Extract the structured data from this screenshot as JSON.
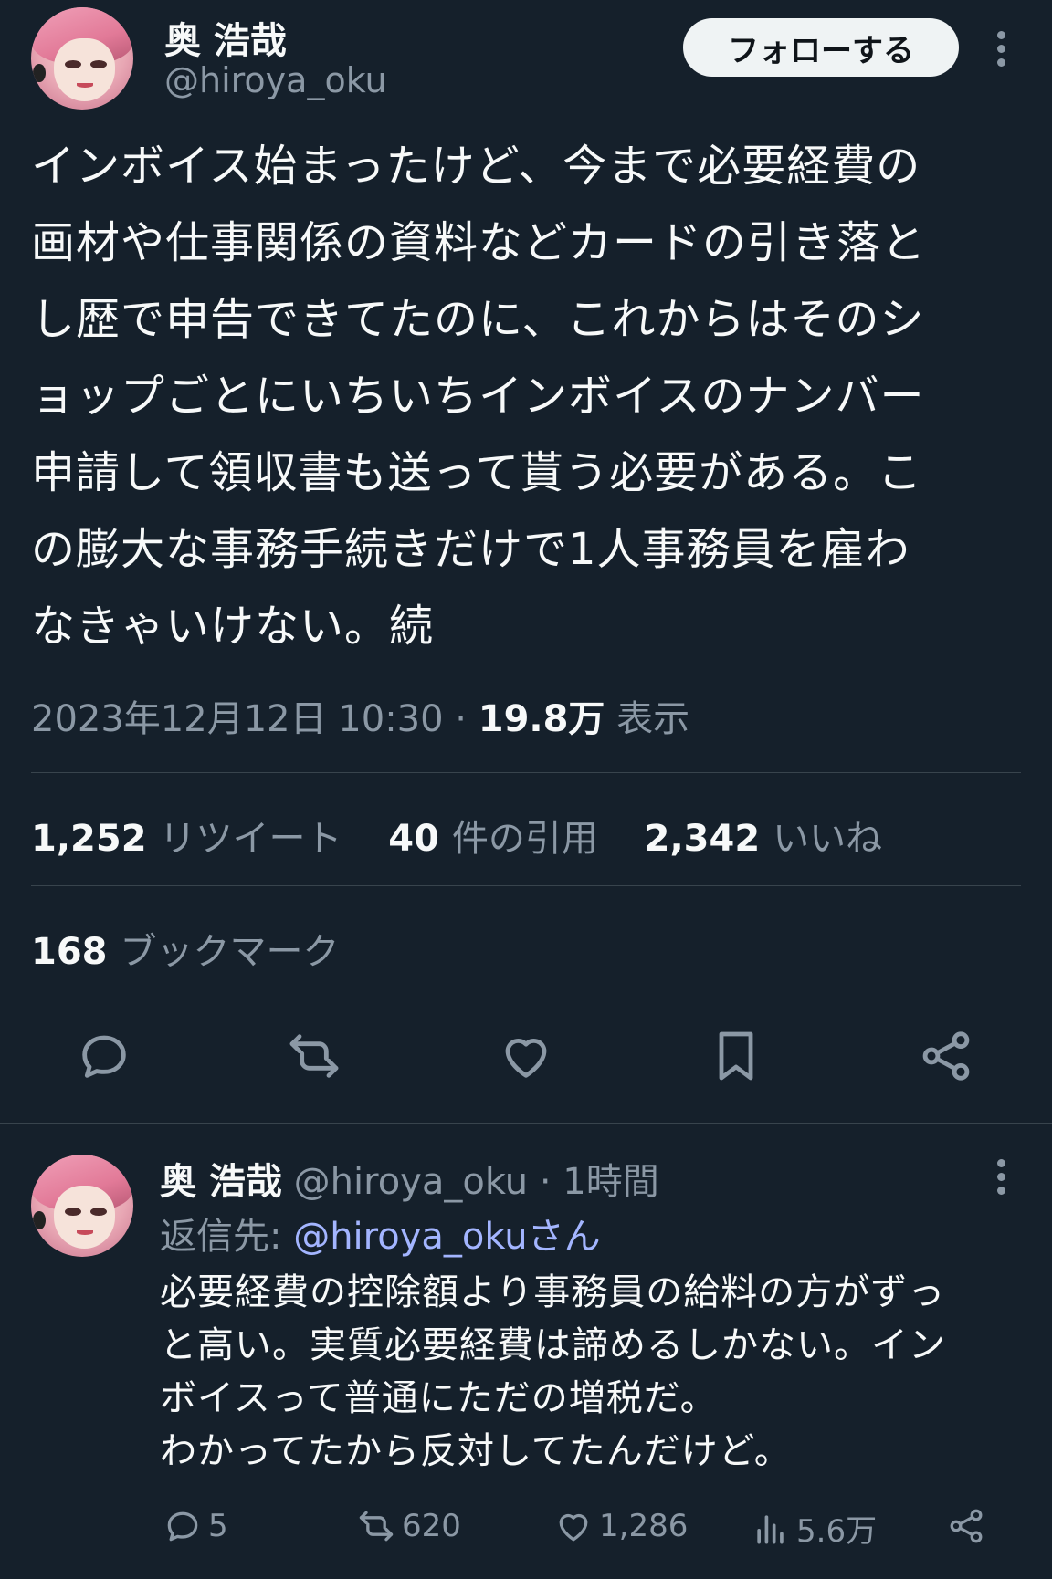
{
  "main": {
    "author_name": "奥 浩哉",
    "author_handle": "@hiroya_oku",
    "follow_label": "フォローする",
    "text_lines": [
      "インボイス始まったけど、今まで必要経費の",
      "画材や仕事関係の資料などカードの引き落と",
      "し歴で申告できてたのに、これからはそのシ",
      "ョップごとにいちいちインボイスのナンバー",
      "申請して領収書も送って貰う必要がある。こ",
      "の膨大な事務手続きだけで1人事務員を雇わ",
      "なきゃいけない。続"
    ],
    "timestamp": "2023年12月12日 10:30 ·",
    "views_count": "19.8万",
    "views_label": "表示",
    "retweets_count": "1,252",
    "retweets_label": "リツイート",
    "quotes_count": "40",
    "quotes_label": "件の引用",
    "likes_count": "2,342",
    "likes_label": "いいね",
    "bookmarks_count": "168",
    "bookmarks_label": "ブックマーク"
  },
  "reply": {
    "author_name": "奥 浩哉",
    "author_handle": "@hiroya_oku · 1時間",
    "reply_to_label": "返信先:",
    "reply_to_mention": "@hiroya_okuさん",
    "text_lines": [
      "必要経費の控除額より事務員の給料の方がずっ",
      "と高い。実質必要経費は諦めるしかない。イン",
      "ボイスって普通にただの増税だ。",
      "わかってたから反対してたんだけど。"
    ],
    "replies": "5",
    "retweets": "620",
    "likes": "1,286",
    "views": "5.6万"
  },
  "icons": [
    "reply-icon",
    "retweet-icon",
    "heart-icon",
    "bookmark-icon",
    "share-icon",
    "views-icon",
    "more-icon"
  ],
  "colors": {
    "background": "#15202b",
    "text": "#f7f9f9",
    "muted": "#8b98a5",
    "divider": "#38444d",
    "mention": "#a3b5ff"
  }
}
